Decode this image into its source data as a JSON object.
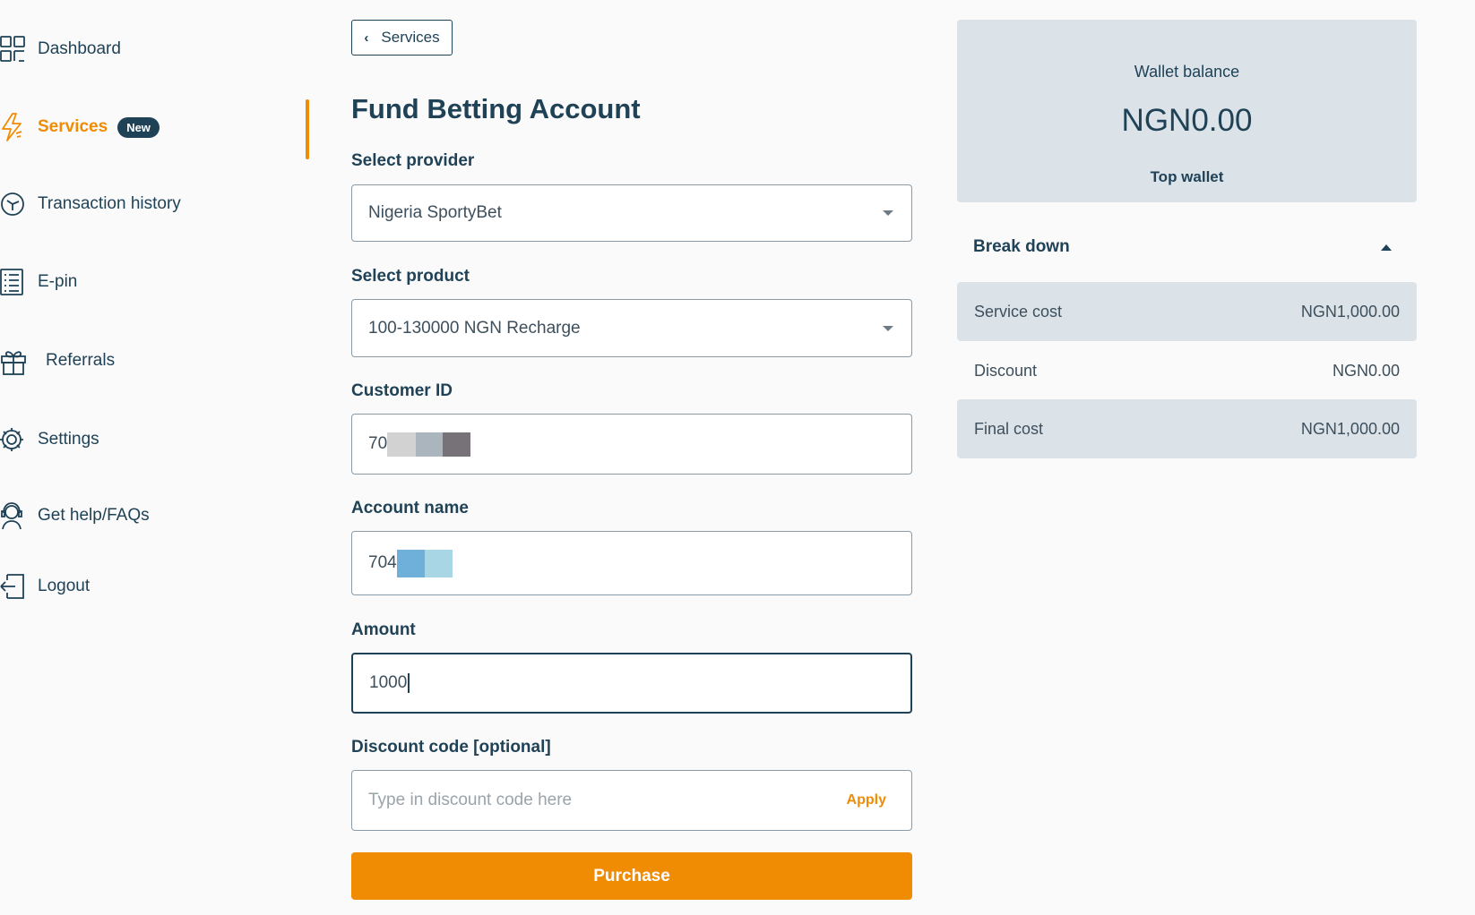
{
  "sidebar": {
    "items": [
      {
        "label": "Dashboard"
      },
      {
        "label": "Services",
        "badge": "New"
      },
      {
        "label": "Transaction history"
      },
      {
        "label": "E-pin"
      },
      {
        "label": "Referrals"
      },
      {
        "label": "Settings"
      },
      {
        "label": "Get help/FAQs"
      },
      {
        "label": "Logout"
      }
    ]
  },
  "main": {
    "back_label": "Services",
    "title": "Fund Betting Account",
    "provider": {
      "label": "Select provider",
      "value": "Nigeria SportyBet"
    },
    "product": {
      "label": "Select product",
      "value": "100-130000 NGN Recharge"
    },
    "customer_id": {
      "label": "Customer ID",
      "value": "70"
    },
    "account_name": {
      "label": "Account name",
      "value": "704"
    },
    "amount": {
      "label": "Amount",
      "value": "1000"
    },
    "discount": {
      "label": "Discount code [optional]",
      "placeholder": "Type in discount code here",
      "apply_label": "Apply"
    },
    "purchase_label": "Purchase"
  },
  "wallet": {
    "title": "Wallet balance",
    "amount": "NGN0.00",
    "top_label": "Top wallet"
  },
  "breakdown": {
    "title": "Break down",
    "rows": [
      {
        "label": "Service cost",
        "value": "NGN1,000.00"
      },
      {
        "label": "Discount",
        "value": "NGN0.00"
      },
      {
        "label": "Final cost",
        "value": "NGN1,000.00"
      }
    ]
  },
  "colors": {
    "accent": "#f08b04",
    "primary": "#1f4257",
    "panel": "#dce3e8"
  }
}
